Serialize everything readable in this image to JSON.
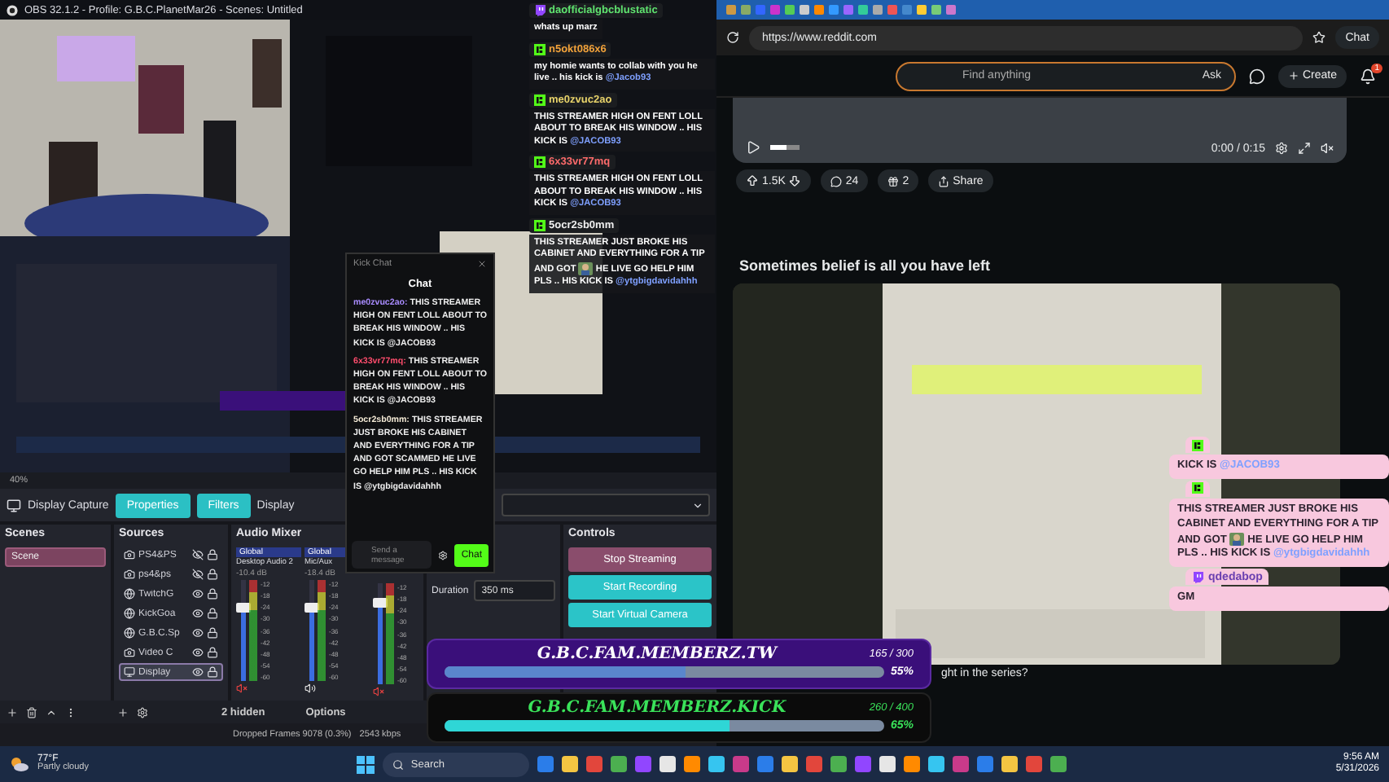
{
  "obs": {
    "title": "OBS 32.1.2 - Profile: G.B.C.PlanetMar26 - Scenes: Untitled",
    "zoom": "40%",
    "context": {
      "source": "Display Capture",
      "buttons": [
        "Properties",
        "Filters"
      ],
      "label": "Display"
    },
    "scenes": {
      "title": "Scenes",
      "items": [
        {
          "label": "Scene",
          "selected": true
        }
      ]
    },
    "sources": {
      "title": "Sources",
      "items": [
        {
          "label": "PS4&PS",
          "kind": "camera",
          "visible": false,
          "selected": false
        },
        {
          "label": "ps4&ps",
          "kind": "camera",
          "visible": false,
          "selected": false
        },
        {
          "label": "TwitchG",
          "kind": "browser",
          "visible": true,
          "selected": false
        },
        {
          "label": "KickGoa",
          "kind": "browser",
          "visible": true,
          "selected": false
        },
        {
          "label": "G.B.C.Sp",
          "kind": "browser",
          "visible": true,
          "selected": false
        },
        {
          "label": "Video C",
          "kind": "camera",
          "visible": true,
          "selected": false
        },
        {
          "label": "Display",
          "kind": "display",
          "visible": true,
          "selected": true
        }
      ]
    },
    "mixer": {
      "title": "Audio Mixer",
      "channels": [
        {
          "tag": "Global",
          "name": "Desktop Audio 2",
          "reading": "-10.4 dB",
          "level": 0.72,
          "muted": true,
          "scale": [
            "-12",
            "-18",
            "-24",
            "-30",
            "-36",
            "-42",
            "-48",
            "-54",
            "-60"
          ]
        },
        {
          "tag": "Global",
          "name": "Mic/Aux",
          "reading": "-18.4 dB",
          "level": 0.72,
          "muted": false,
          "scale": [
            "-12",
            "-18",
            "-24",
            "-30",
            "-36",
            "-42",
            "-48",
            "-54",
            "-60"
          ]
        },
        {
          "level": 0.8,
          "muted": true,
          "scale": [
            "-12",
            "-18",
            "-24",
            "-30",
            "-36",
            "-42",
            "-48",
            "-54",
            "-60"
          ]
        }
      ]
    },
    "transitions": {
      "duration_label": "Duration",
      "duration": "350 ms"
    },
    "controls": {
      "title": "Controls",
      "buttons": [
        {
          "label": "Stop Streaming",
          "kind": "stop"
        },
        {
          "label": "Start Recording",
          "kind": "start"
        },
        {
          "label": "Start Virtual Camera",
          "kind": "start"
        }
      ]
    },
    "toolbar": {
      "hidden": "2 hidden",
      "options": "Options"
    },
    "status": {
      "dropped": "Dropped Frames 9078 (0.3%)",
      "bitrate": "2543 kbps"
    }
  },
  "browser": {
    "url": "https://www.reddit.com",
    "chat": "Chat",
    "search": {
      "placeholder": "Find anything"
    },
    "ask": "Ask",
    "create": "Create",
    "notifications": "1",
    "video": {
      "time": "0:00 / 0:15",
      "level": 0.55
    },
    "actions": {
      "votes": "1.5K",
      "comments": "24",
      "awards": "2",
      "share": "Share"
    },
    "post_title": "Sometimes belief is all you have left",
    "next_post": "ght in the series?"
  },
  "top_chat": [
    {
      "kind": "twitch",
      "user": "daofficialgbcblustatic",
      "color": "#5fe36f",
      "text": "whats up marz"
    },
    {
      "kind": "kick",
      "user": "n5okt086x6",
      "color": "#f2a23a",
      "text": "my homie wants to collab with you he live .. his kick is ",
      "mention": "@Jacob93"
    },
    {
      "kind": "kick",
      "user": "me0zvuc2ao",
      "color": "#e8d36a",
      "text": "THIS STREAMER HIGH ON FENT LOLL ABOUT TO BREAK HIS WINDOW .. HIS KICK IS ",
      "mention": "@JACOB93"
    },
    {
      "kind": "kick",
      "user": "6x33vr77mq",
      "color": "#ff6b6b",
      "text": "THIS STREAMER HIGH ON FENT LOLL ABOUT TO BREAK HIS WINDOW .. HIS KICK IS ",
      "mention": "@JACOB93"
    },
    {
      "kind": "kick",
      "user": "5ocr2sb0mm",
      "color": "#f0f0f0",
      "text": "THIS STREAMER JUST BROKE HIS CABINET AND EVERYTHING FOR A TIP AND GOT",
      "emote": true,
      "text2": "HE LIVE GO HELP HIM PLS .. HIS KICK IS ",
      "mention": "@ytgbigdavidahhh"
    }
  ],
  "kick_chat": {
    "title": "Kick Chat",
    "header": "Chat",
    "messages": [
      {
        "user": "me0zvuc2ao:",
        "color": "#a98cff",
        "text": "THIS STREAMER HIGH ON FENT LOLL ABOUT TO BREAK HIS WINDOW .. HIS KICK IS @JACOB93"
      },
      {
        "user": "6x33vr77mq:",
        "color": "#ff4d6d",
        "text": "THIS STREAMER HIGH ON FENT LOLL ABOUT TO BREAK HIS WINDOW .. HIS KICK IS @JACOB93"
      },
      {
        "user": "5ocr2sb0mm:",
        "color": "#f4ead6",
        "text": "THIS STREAMER JUST BROKE HIS CABINET AND EVERYTHING FOR A TIP AND GOT SCAMMED HE LIVE GO HELP HIM PLS .. HIS KICK IS @ytgbigdavidahhh"
      }
    ],
    "placeholder": "Send a message",
    "send": "Chat"
  },
  "side_chat": [
    {
      "kind": "kick",
      "text": "KICK IS ",
      "mention": "@JACOB93"
    },
    {
      "kind": "kick",
      "text": "THIS STREAMER JUST BROKE HIS CABINET AND EVERYTHING FOR A TIP AND GOT",
      "emote": true,
      "text2": "HE LIVE GO HELP HIM PLS .. HIS KICK IS ",
      "mention": "@ytgbigdavidahhh"
    },
    {
      "kind": "twitch",
      "user": "qdedabop",
      "text": "GM"
    }
  ],
  "goals": [
    {
      "kind": "twitch",
      "title": "G.B.C.FAM.MEMBERZ.TW",
      "count": "165 / 300",
      "percent": "55%",
      "level": 0.55
    },
    {
      "kind": "kick",
      "title": "G.B.C.FAM.MEMBERZ.KICK",
      "count": "260 / 400",
      "percent": "65%",
      "level": 0.65
    }
  ],
  "taskbar": {
    "temp": "77°F",
    "weather": "Partly cloudy",
    "search": "Search",
    "time": "9:56 AM",
    "date": "5/31/2026"
  }
}
